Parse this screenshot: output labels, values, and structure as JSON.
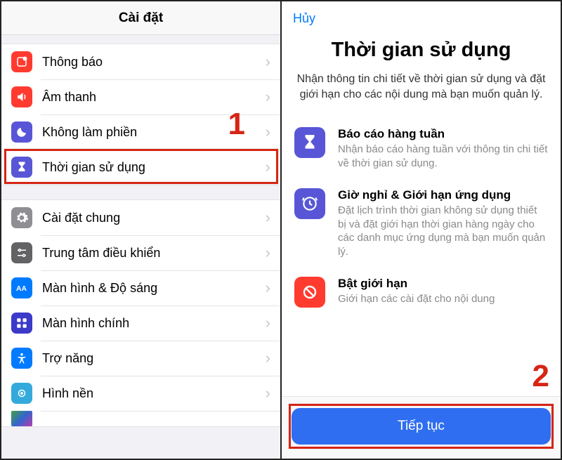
{
  "left": {
    "title": "Cài đặt",
    "group1": [
      {
        "label": "Thông báo",
        "icon": "notification-icon",
        "color": "ic-red"
      },
      {
        "label": "Âm thanh",
        "icon": "sound-icon",
        "color": "ic-red"
      },
      {
        "label": "Không làm phiền",
        "icon": "dnd-icon",
        "color": "ic-purple"
      },
      {
        "label": "Thời gian sử dụng",
        "icon": "screentime-icon",
        "color": "ic-purple"
      }
    ],
    "group2": [
      {
        "label": "Cài đặt chung",
        "icon": "gear-icon",
        "color": "ic-grey"
      },
      {
        "label": "Trung tâm điều khiển",
        "icon": "control-center-icon",
        "color": "ic-dgrey"
      },
      {
        "label": "Màn hình & Độ sáng",
        "icon": "display-icon",
        "color": "ic-blue"
      },
      {
        "label": "Màn hình chính",
        "icon": "home-screen-icon",
        "color": "ic-purple"
      },
      {
        "label": "Trợ năng",
        "icon": "accessibility-icon",
        "color": "ic-blue"
      },
      {
        "label": "Hình nền",
        "icon": "wallpaper-icon",
        "color": "ic-teal"
      }
    ]
  },
  "right": {
    "cancel": "Hủy",
    "title": "Thời gian sử dụng",
    "desc": "Nhận thông tin chi tiết về thời gian sử dụng và đặt giới hạn cho các nội dung mà bạn muốn quản lý.",
    "features": [
      {
        "title": "Báo cáo hàng tuần",
        "desc": "Nhận báo cáo hàng tuần với thông tin chi tiết về thời gian sử dụng.",
        "icon": "hourglass-icon",
        "color": "#5856d6"
      },
      {
        "title": "Giờ nghỉ & Giới hạn ứng dụng",
        "desc": "Đặt lịch trình thời gian không sử dụng thiết bị và đặt giới hạn thời gian hàng ngày cho các danh mục ứng dụng mà bạn muốn quản lý.",
        "icon": "clock-icon",
        "color": "#5856d6"
      },
      {
        "title": "Bật giới hạn",
        "desc": "Giới hạn các cài đặt cho nội dung",
        "icon": "restrict-icon",
        "color": "#ff3b30"
      }
    ],
    "continue": "Tiếp tục"
  },
  "annotations": {
    "step1": "1",
    "step2": "2"
  }
}
